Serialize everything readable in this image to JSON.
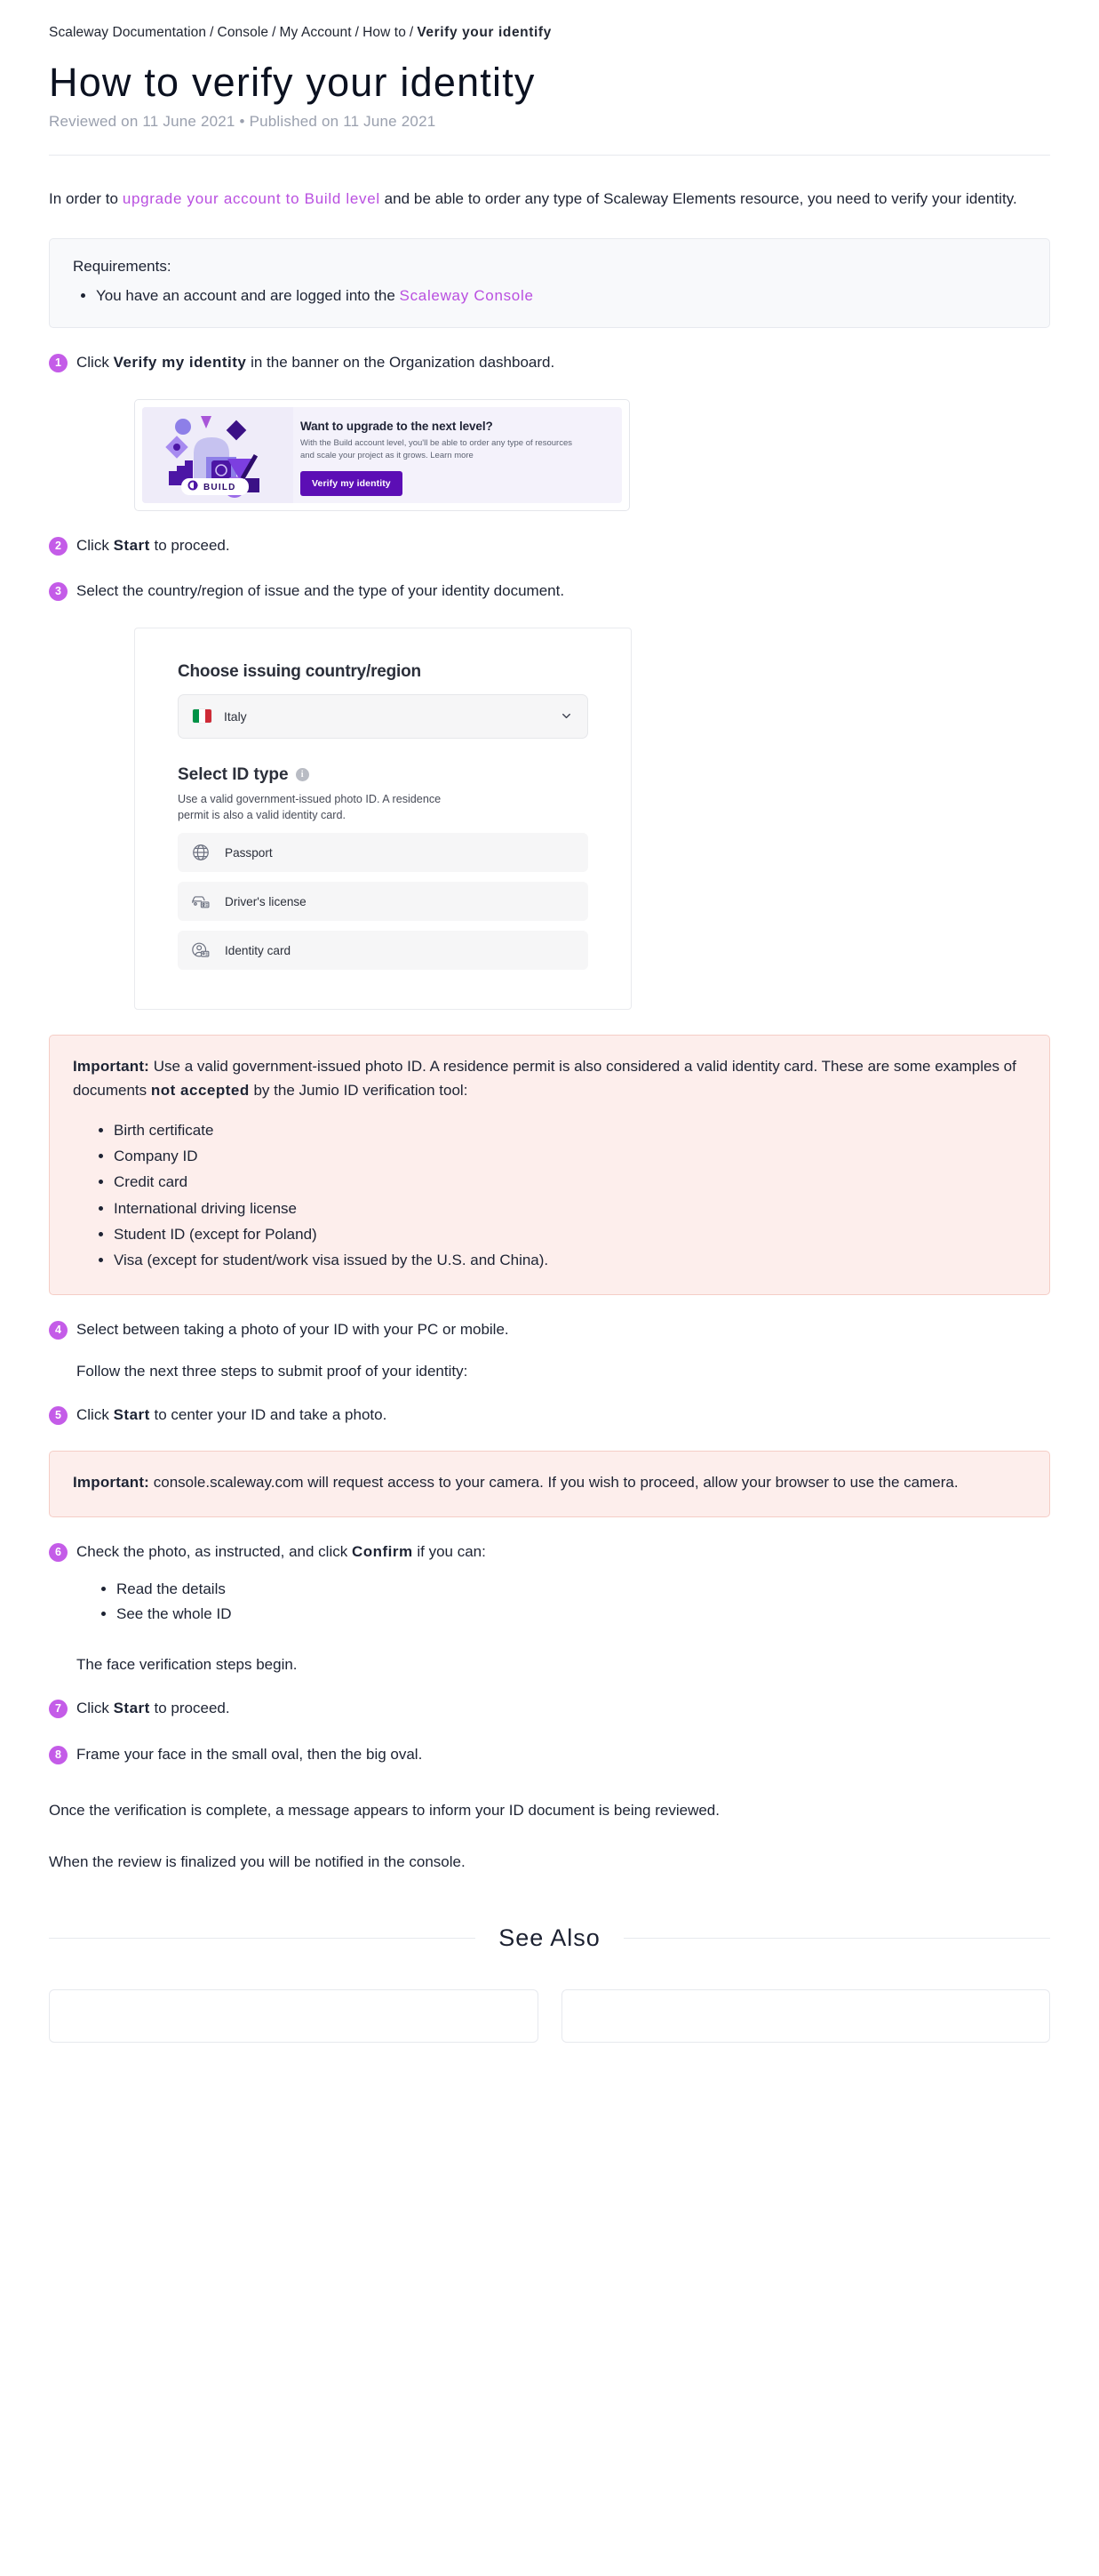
{
  "breadcrumb": {
    "items": [
      "Scaleway Documentation",
      "Console",
      "My Account",
      "How to"
    ],
    "current": "Verify your identify",
    "separator": "/"
  },
  "header": {
    "title": "How to verify your identity",
    "meta": "Reviewed on 11 June 2021 • Published on 11 June 2021"
  },
  "intro": {
    "before": "In order to ",
    "link": "upgrade your account to Build level",
    "after": " and be able to order any type of Scaleway Elements resource, you need to verify your identity."
  },
  "requirements": {
    "title": "Requirements:",
    "items": [
      {
        "before": "You have an account and are logged into the ",
        "link": "Scaleway Console"
      }
    ]
  },
  "steps": [
    {
      "num": "1",
      "before": "Click ",
      "bold": "Verify my identity",
      "after": " in the banner on the Organization dashboard."
    },
    {
      "num": "2",
      "before": "Click ",
      "bold": "Start",
      "after": " to proceed."
    },
    {
      "num": "3",
      "before": "Select the country/region of issue and the type of your identity document.",
      "bold": "",
      "after": ""
    },
    {
      "num": "4",
      "before": "Select between taking a photo of your ID with your PC or mobile.",
      "bold": "",
      "after": ""
    },
    {
      "num": "5",
      "before": "Click ",
      "bold": "Start",
      "after": " to center your ID and take a photo."
    },
    {
      "num": "6",
      "before": "Check the photo, as instructed, and click ",
      "bold": "Confirm",
      "after": " if you can:"
    },
    {
      "num": "7",
      "before": "Click ",
      "bold": "Start",
      "after": " to proceed."
    },
    {
      "num": "8",
      "before": "Frame your face in the small oval, then the big oval.",
      "bold": "",
      "after": ""
    }
  ],
  "banner_screenshot": {
    "badge_label": "BUILD",
    "heading": "Want to upgrade to the next level?",
    "paragraph": "With the Build account level, you'll be able to order any type of resources and scale your project as it grows. Learn more",
    "button": "Verify my identity"
  },
  "id_card_screenshot": {
    "country_heading": "Choose issuing country/region",
    "country_value": "Italy",
    "country_flag": "italy-flag-icon",
    "chevron": "chevron-down-icon",
    "id_type_heading": "Select ID type",
    "info_icon": "info-icon",
    "id_type_description": "Use a valid government-issued photo ID. A residence permit is also a valid identity card.",
    "options": [
      {
        "label": "Passport",
        "icon": "globe-icon"
      },
      {
        "label": "Driver's license",
        "icon": "car-license-icon"
      },
      {
        "label": "Identity card",
        "icon": "identity-card-icon"
      }
    ]
  },
  "callout_documents": {
    "label": "Important:",
    "text": " Use a valid government-issued photo ID. A residence permit is also considered a valid identity card. These are some examples of documents ",
    "emphasis": "not accepted",
    "text_after": " by the Jumio ID verification tool:",
    "items": [
      "Birth certificate",
      "Company ID",
      "Credit card",
      "International driving license",
      "Student ID (except for Poland)",
      "Visa (except for student/work visa issued by the U.S. and China)."
    ]
  },
  "follow_note": "Follow the next three steps to submit proof of your identity:",
  "callout_camera": {
    "label": "Important:",
    "text": " console.scaleway.com will request access to your camera. If you wish to proceed, allow your browser to use the camera."
  },
  "confirm_checks": [
    "Read the details",
    "See the whole ID"
  ],
  "face_note": "The face verification steps begin.",
  "closing": [
    "Once the verification is complete, a message appears to inform your ID document is being reviewed.",
    "When the review is finalized you will be notified in the console."
  ],
  "see_also": {
    "label": "See Also"
  },
  "colors": {
    "link": "#b94fe0",
    "step_badge": "#c45ce8",
    "callout_bg": "#fdeeec",
    "callout_border": "#f5cdc6",
    "requirements_bg": "#f8f9fb",
    "banner_button": "#5c0eb5"
  }
}
